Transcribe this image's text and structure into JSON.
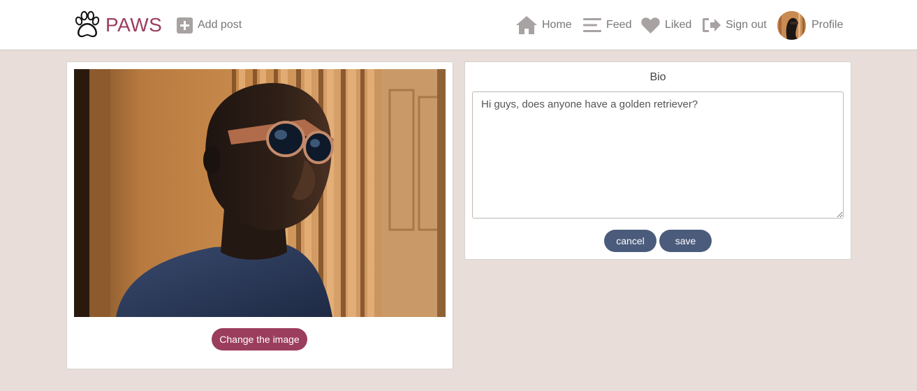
{
  "brand": {
    "name": "PAWS",
    "icon": "paw-icon"
  },
  "nav": {
    "add_post": {
      "label": "Add post",
      "icon": "plus-square-icon"
    },
    "home": {
      "label": "Home",
      "icon": "home-icon"
    },
    "feed": {
      "label": "Feed",
      "icon": "menu-icon"
    },
    "liked": {
      "label": "Liked",
      "icon": "heart-icon"
    },
    "sign_out": {
      "label": "Sign out",
      "icon": "sign-out-icon"
    },
    "profile": {
      "label": "Profile",
      "icon": "avatar"
    }
  },
  "image_card": {
    "change_button_label": "Change the image"
  },
  "bio_card": {
    "title": "Bio",
    "bio_value": "Hi guys, does anyone have a golden retriever?",
    "cancel_label": "cancel",
    "save_label": "save"
  },
  "colors": {
    "brand": "#9b3d5c",
    "primary_button": "#4a5b7c",
    "background": "#e8ddd8",
    "nav_icon": "#a8a2a3"
  }
}
